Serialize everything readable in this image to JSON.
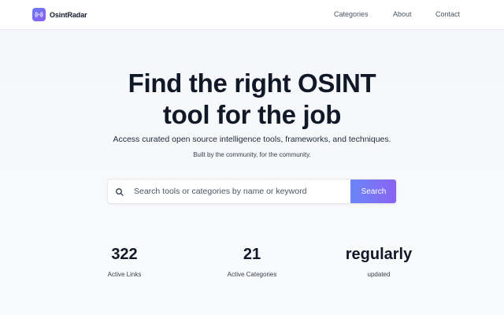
{
  "brand": {
    "name": "OsintRadar",
    "logo_icon": "radar-signal-icon",
    "logo_colors": [
      "#6a7cf8",
      "#8a5cf2"
    ]
  },
  "nav": {
    "items": [
      {
        "label": "Categories"
      },
      {
        "label": "About"
      },
      {
        "label": "Contact"
      }
    ]
  },
  "hero": {
    "title_line1": "Find the right OSINT",
    "title_line2": "tool for the job",
    "subtitle": "Access curated open source intelligence tools, frameworks, and techniques.",
    "tagline": "Built by the community, for the community."
  },
  "search": {
    "value": "",
    "placeholder": "Search tools or categories by name or keyword",
    "button_label": "Search",
    "icon": "search-icon",
    "button_colors": [
      "#6a86f8",
      "#8b62f2"
    ]
  },
  "stats": [
    {
      "value": "322",
      "label": "Active Links"
    },
    {
      "value": "21",
      "label": "Active Categories"
    },
    {
      "value": "regularly",
      "label": "updated"
    }
  ]
}
